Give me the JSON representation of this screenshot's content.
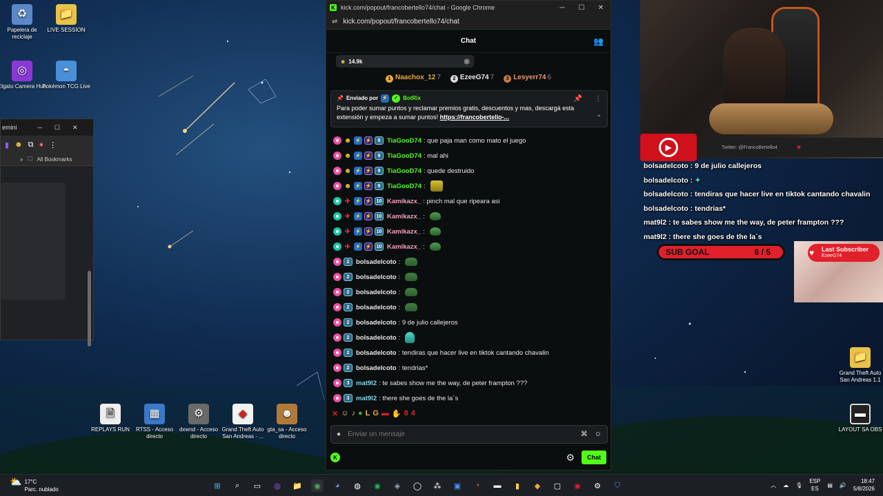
{
  "desktop": {
    "icons": [
      {
        "label": "Papelera de reciclaje",
        "icon": "recycle-bin-icon"
      },
      {
        "label": "LIVE SESSION",
        "icon": "folder-icon"
      },
      {
        "label": "Elgato Camera Hub",
        "icon": "elgato-icon"
      },
      {
        "label": "Pokémon TCG Live",
        "icon": "pokemon-icon"
      },
      {
        "label": "REPLAYS RUN",
        "icon": "file-icon"
      },
      {
        "label": "RTSS - Acceso directo",
        "icon": "rtss-icon"
      },
      {
        "label": "dxwnd - Acceso directo",
        "icon": "dxwnd-icon"
      },
      {
        "label": "Grand Theft Auto San Andreas - ...",
        "icon": "gta-icon"
      },
      {
        "label": "gta_sa - Acceso directo",
        "icon": "gta-sa-icon"
      },
      {
        "label": "Grand Theft Auto San Andreas 1.1",
        "icon": "folder-icon"
      },
      {
        "label": "LAYOUT SA OBS",
        "icon": "obs-layout-icon"
      }
    ]
  },
  "left_browser": {
    "tab_label": "emini",
    "bookmarks_label": "All Bookmarks"
  },
  "chat_window": {
    "title": "kick.com/popout/francobertello74/chat - Google Chrome",
    "url": "kick.com/popout/francobertello74/chat",
    "header": "Chat",
    "points": "14.9k",
    "leaderboard": [
      {
        "name": "Naachox_12",
        "rank": "7",
        "color": "#e8a93a"
      },
      {
        "name": "EzeeG74",
        "rank": "7",
        "color": "#d9d9d9"
      },
      {
        "name": "Lesyerr74",
        "rank": "6",
        "color": "#c8794a"
      }
    ],
    "pinned": {
      "prefix": "Enviado por",
      "sender": "BotRix",
      "text": "Para poder sumar puntos y reclamar premios gratis, descuentos y mas, descargá esta extensión y empeza a sumar puntos!",
      "link": "https://francobertello-..."
    },
    "messages": [
      {
        "user": "TiaGooD74",
        "text": ": que paja man como mato el juego",
        "color": "#53fc18",
        "badge": "9"
      },
      {
        "user": "TiaGooD74",
        "text": ": mal ahi",
        "color": "#53fc18",
        "badge": "9"
      },
      {
        "user": "TiaGooD74",
        "text": ": quede destruido",
        "color": "#53fc18",
        "badge": "9"
      },
      {
        "user": "TiaGooD74",
        "text": ":",
        "color": "#53fc18",
        "badge": "9"
      },
      {
        "user": "Kamikazx_",
        "text": ": pinch mal que ripeara asi",
        "color": "#f2a0b8",
        "badge": "10"
      },
      {
        "user": "Kamikazx_",
        "text": ":",
        "color": "#f2a0b8",
        "badge": "10"
      },
      {
        "user": "Kamikazx_",
        "text": ":",
        "color": "#f2a0b8",
        "badge": "10"
      },
      {
        "user": "Kamikazx_",
        "text": ":",
        "color": "#f2a0b8",
        "badge": "10"
      },
      {
        "user": "bolsadelcoto",
        "text": ":",
        "color": "#ffffff",
        "badge": "2"
      },
      {
        "user": "bolsadelcoto",
        "text": ":",
        "color": "#ffffff",
        "badge": "2"
      },
      {
        "user": "bolsadelcoto",
        "text": ":",
        "color": "#ffffff",
        "badge": "2"
      },
      {
        "user": "bolsadelcoto",
        "text": ":",
        "color": "#ffffff",
        "badge": "2"
      },
      {
        "user": "bolsadelcoto",
        "text": ": 9 de julio callejeros",
        "color": "#ffffff",
        "badge": "2"
      },
      {
        "user": "bolsadelcoto",
        "text": ":",
        "color": "#ffffff",
        "badge": "2"
      },
      {
        "user": "bolsadelcoto",
        "text": ": tendiras que hacer live en tiktok cantando chavalin",
        "color": "#ffffff",
        "badge": "2"
      },
      {
        "user": "bolsadelcoto",
        "text": ": tendrias*",
        "color": "#ffffff",
        "badge": "2"
      },
      {
        "user": "mat9l2",
        "text": ": te sabes show me the way, de peter frampton ???",
        "color": "#7fd6e8",
        "badge": "3"
      },
      {
        "user": "mat9l2",
        "text": ": there she goes de the la´s",
        "color": "#7fd6e8",
        "badge": "3"
      }
    ],
    "input_placeholder": "Enviar un mensaje",
    "send_label": "Chat"
  },
  "overlay": {
    "twitter_handle": "Twitter: @FrancoBertello4",
    "chat": [
      "bolsadelcoto : 9 de julio callejeros",
      "bolsadelcoto :",
      "bolsadelcoto : tendiras que hacer live en tiktok cantando chavalin",
      "bolsadelcoto : tendrias*",
      "mat9l2 : te sabes show me the way, de peter frampton ???",
      "mat9l2 : there she goes de the la´s"
    ],
    "sub_goal_label": "SUB GOAL",
    "sub_goal_value": "6 / 5",
    "last_subscriber_label": "Last Subscriber",
    "last_subscriber_name": "EzeeG74"
  },
  "taskbar": {
    "temperature": "17°C",
    "weather": "Parc. nublado",
    "lang_top": "ESP",
    "lang_bottom": "ES",
    "time": "18:47",
    "date": "5/8/2026"
  }
}
